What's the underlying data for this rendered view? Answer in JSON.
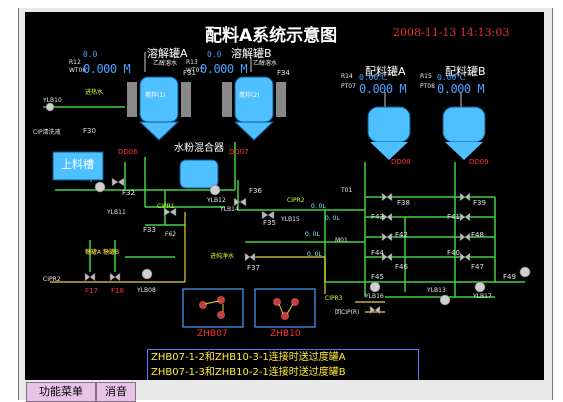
{
  "title": "配料A系统示意图",
  "datetime": "2008-11-13 14:13:03",
  "tanks": {
    "dissolve_a": {
      "label": "溶解罐A",
      "inner": "搅拌(1)",
      "id": "DD06",
      "sensor": "R12",
      "wt": "WT06",
      "value": "0.000 M",
      "value2": "0.0",
      "tag_f31": "F31",
      "tag_top": "乙醇溶水"
    },
    "dissolve_b": {
      "label": "溶解罐B",
      "inner": "搅拌(2)",
      "id": "DD07",
      "sensor": "R13",
      "wt": "WT07",
      "value": "0.000 M",
      "value2": "0.0",
      "tag_f34": "F34",
      "tag_top": "乙醇溶水"
    },
    "mix_a": {
      "label": "配料罐A",
      "id": "DD08",
      "sensor": "R14",
      "pt": "PT07",
      "value": "0.000 M",
      "value2": "0.00℃"
    },
    "mix_b": {
      "label": "配料罐B",
      "id": "DD09",
      "sensor": "R15",
      "pt": "PT08",
      "value": "0.000 M",
      "value2": "0.00℃"
    },
    "feed": {
      "label": "上料槽"
    },
    "water_mixer": {
      "label": "水粉混合器"
    }
  },
  "labels": {
    "yl810": "YLB10",
    "water_in": "进热水",
    "cip_in": "CIP清洗液",
    "f30": "F30",
    "f32": "F32",
    "ylb11": "YLB11",
    "ylb12": "YLB12",
    "cipr1": "CIPR1",
    "f33": "F33",
    "f62": "F62",
    "ylb14": "YLB14",
    "ylb15": "YLB15",
    "f35": "F35",
    "f36": "F36",
    "cipr2": "CIPR2",
    "f37": "F37",
    "f38": "F38",
    "f39": "F39",
    "f40": "F40",
    "f41": "F41",
    "f42": "F42",
    "f43": "F43",
    "f44": "F44",
    "f45": "F45",
    "f46": "F46",
    "f47": "F47",
    "f48": "F48",
    "cipr3": "CIPR3",
    "cip_back": "回CIP(R)",
    "cipr2b": "CIPR2",
    "f17": "F17",
    "f18": "F18",
    "ylb08": "YLB08",
    "ylb16": "YLB16",
    "ylb17": "YLB17",
    "ylb13": "YLB13",
    "f49": "F49",
    "tank_ab": "糖罐A 糖罐B",
    "water_pure": "进纯净水",
    "t01": "T01",
    "m01": "M01",
    "flow1": "0. 0L",
    "flow2": "0. 0L",
    "flow3": "0. 0L",
    "flow4": "0. 0L"
  },
  "machines": {
    "zhb07": "ZHB07",
    "zhb10": "ZHB10"
  },
  "status": {
    "line1": "ZHB07-1-2和ZHB10-3-1连接时送过度罐A",
    "line2": "ZHB07-1-3和ZHB10-2-1连接时送过度罐B"
  },
  "buttons": {
    "menu": "功能菜单",
    "mute": "消音"
  }
}
